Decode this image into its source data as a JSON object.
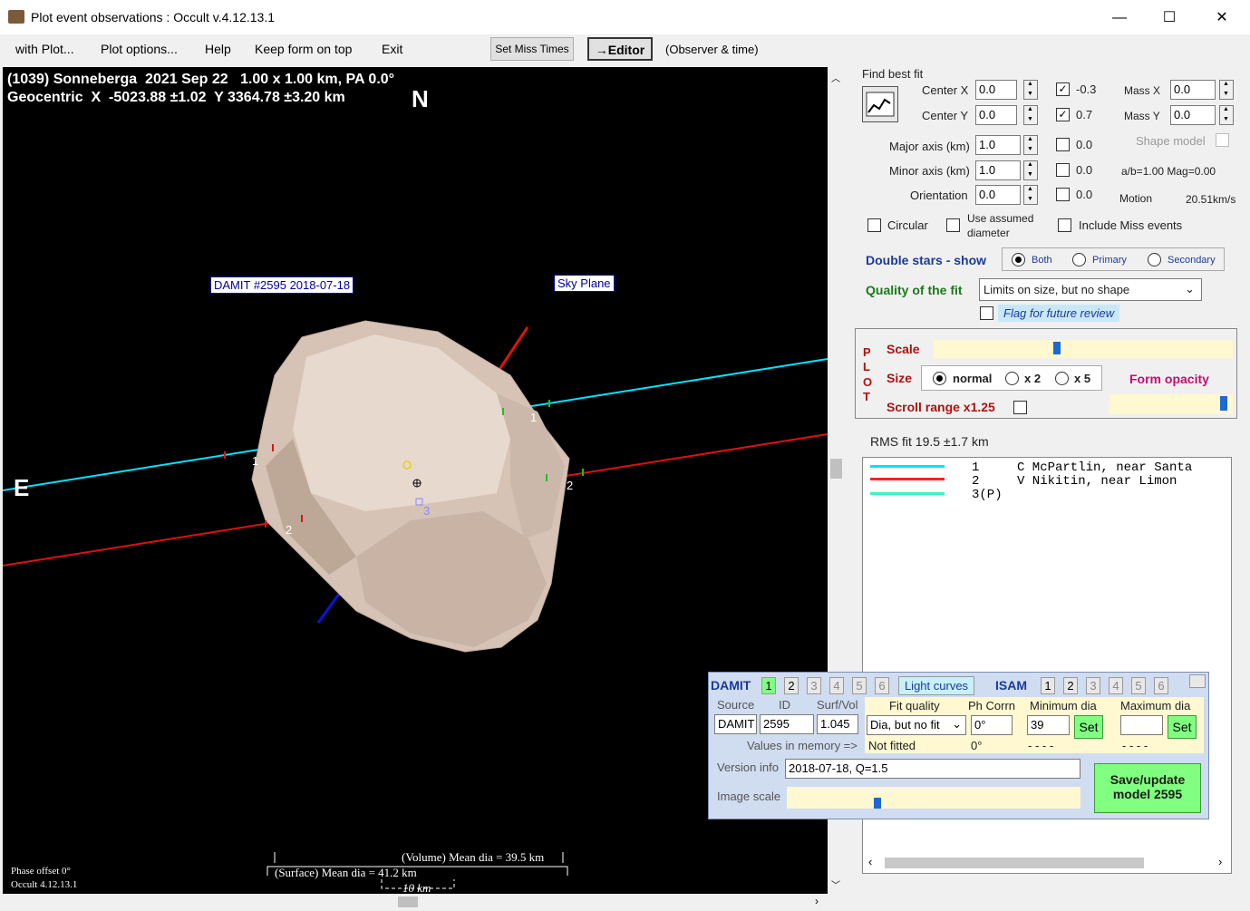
{
  "window": {
    "title": "Plot event observations : Occult v.4.12.13.1",
    "min": "—",
    "max": "☐",
    "close": "✕"
  },
  "menu": [
    "with Plot...",
    "Plot options...",
    "Help",
    "Keep form on top",
    "Exit"
  ],
  "toolbar": {
    "set_miss_times": "Set Miss Times",
    "editor": "→Editor",
    "observer_time": "(Observer & time)"
  },
  "plot": {
    "header1": "(1039) Sonneberga  2021 Sep 22   1.00 x 1.00 km, PA 0.0°",
    "header2": "Geocentric  X  -5023.88 ±1.02  Y 3364.78 ±3.20 km",
    "north": "N",
    "east": "E",
    "damit_label": "DAMIT #2595 2018-07-18",
    "sky_plane": "Sky Plane",
    "chord_labels": [
      "1",
      "2",
      "1",
      "2",
      "3"
    ],
    "phase_offset": "Phase offset 0°",
    "occult_version": "Occult 4.12.13.1",
    "volume_dia": "(Volume) Mean dia = 39.5 km",
    "surface_dia": "(Surface) Mean dia = 41.2 km",
    "scale_km": "10 km"
  },
  "fit": {
    "find_best_fit": "Find best fit",
    "center_x_label": "Center X",
    "center_x": "0.0",
    "cx_check": "-0.3",
    "center_y_label": "Center Y",
    "center_y": "0.0",
    "cy_check": "0.7",
    "mass_x_label": "Mass X",
    "mass_x": "0.0",
    "mass_y_label": "Mass Y",
    "mass_y": "0.0",
    "major_label": "Major axis (km)",
    "major": "1.0",
    "major_check": "0.0",
    "minor_label": "Minor axis (km)",
    "minor": "1.0",
    "minor_check": "0.0",
    "orient_label": "Orientation",
    "orient": "0.0",
    "orient_check": "0.0",
    "shape_model": "Shape model",
    "ab_mag": "a/b=1.00  Mag=0.00",
    "motion_label": "Motion",
    "motion": "20.51km/s",
    "circular": "Circular",
    "use_assumed": "Use assumed",
    "diameter": "diameter",
    "include_miss": "Include Miss events"
  },
  "double_stars": {
    "label": "Double stars - show",
    "both": "Both",
    "primary": "Primary",
    "secondary": "Secondary"
  },
  "quality": {
    "label": "Quality of the fit",
    "value": "Limits on size, but no shape",
    "flag": "Flag for future review"
  },
  "plotpanel": {
    "p": "P",
    "l": "L",
    "o": "O",
    "t": "T",
    "scale": "Scale",
    "size": "Size",
    "normal": "normal",
    "x2": "x 2",
    "x5": "x 5",
    "form_opacity": "Form opacity",
    "scroll_range": "Scroll range x1.25"
  },
  "rms": "RMS fit  19.5 ±1.7 km",
  "legend": [
    {
      "n": "1",
      "name": "C McPartlin, near Santa",
      "color": "#00e5ff"
    },
    {
      "n": "2",
      "name": "V Nikitin, near Limon",
      "color": "#ff2020"
    },
    {
      "n": "3(P)",
      "name": "",
      "color": "#40f0c0"
    }
  ],
  "damit": {
    "damit_label": "DAMIT",
    "damit_tabs": [
      "1",
      "2",
      "3",
      "4",
      "5",
      "6"
    ],
    "light_curves": "Light curves",
    "isam_label": "ISAM",
    "isam_tabs": [
      "1",
      "2",
      "3",
      "4",
      "5",
      "6"
    ],
    "source_h": "Source",
    "id_h": "ID",
    "surf_h": "Surf/Vol",
    "source": "DAMIT",
    "id": "2595",
    "surf": "1.045",
    "fitq_h": "Fit quality",
    "phcorr_h": "Ph Corrn",
    "mindia_h": "Minimum dia",
    "maxdia_h": "Maximum dia",
    "fitq": "Dia, but no fit",
    "phcorr": "0°",
    "mindia": "39",
    "maxdia": "",
    "set": "Set",
    "values_mem": "Values in memory =>",
    "not_fitted": "Not fitted",
    "ph_mem": "0°",
    "dash1": "- - - -",
    "dash2": "- - - -",
    "version_label": "Version info",
    "version": "2018-07-18, Q=1.5",
    "image_scale": "Image scale",
    "save": "Save/update model 2595"
  }
}
